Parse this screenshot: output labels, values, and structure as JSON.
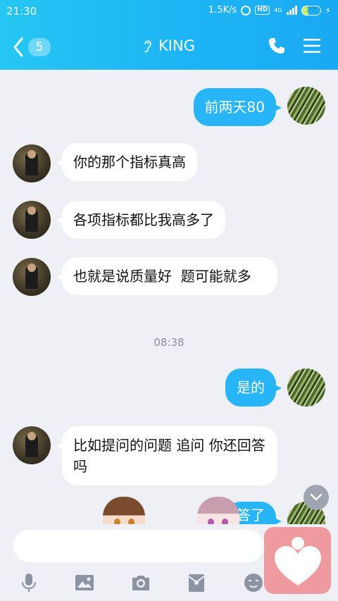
{
  "status_bar": {
    "time": "21:30",
    "network_speed": "1.5K/s",
    "hd": "HD",
    "network_type": "4G",
    "battery": "37",
    "battery_level": 0.37
  },
  "header": {
    "back_count": "5",
    "title": "KING",
    "icons": [
      "chevron-left-icon",
      "ear-icon",
      "phone-icon",
      "menu-icon"
    ]
  },
  "messages": [
    {
      "side": "out",
      "text": "前两天80"
    },
    {
      "side": "in",
      "text": "你的那个指标真高"
    },
    {
      "side": "in",
      "text": "各项指标都比我高多了"
    },
    {
      "side": "in",
      "text": "也就是说质量好  题可能就多"
    },
    {
      "side": "time",
      "text": "08:38"
    },
    {
      "side": "out",
      "text": "是的"
    },
    {
      "side": "in",
      "text": "比如提问的问题 追问 你还回答吗"
    },
    {
      "side": "out",
      "text": "答了"
    }
  ],
  "input": {
    "value": "",
    "placeholder": ""
  },
  "toolbar": {
    "icons": [
      "microphone-icon",
      "image-icon",
      "camera-icon",
      "red-packet-icon",
      "emoji-icon"
    ]
  },
  "colors": {
    "header_start": "#25c6f3",
    "header_end": "#1aa9f3",
    "outgoing_bubble": "#27b5f7",
    "incoming_bubble": "#ffffff",
    "background": "#eef0f5",
    "heart_button": "#ef9a9f"
  }
}
